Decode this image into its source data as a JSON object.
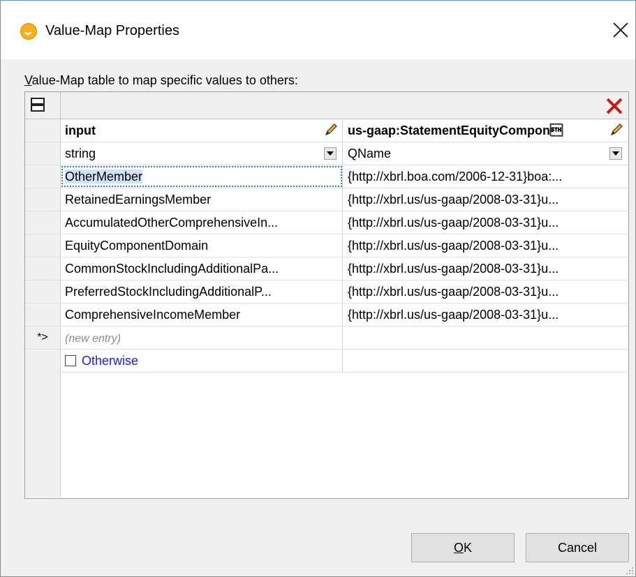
{
  "window": {
    "title": "Value-Map Properties",
    "icon": "altova-mapforce-icon"
  },
  "description": {
    "first_letter": "V",
    "rest": "alue-Map table to map specific values to others:"
  },
  "table": {
    "columns": [
      {
        "header": "input",
        "type": "string"
      },
      {
        "header": "us-gaap:StatementEquityCompon\u0002",
        "type": "QName"
      }
    ],
    "rows": [
      {
        "input": "OtherMember",
        "output": "{http://xbrl.boa.com/2006-12-31}boa:..."
      },
      {
        "input": "RetainedEarningsMember",
        "output": "{http://xbrl.us/us-gaap/2008-03-31}u..."
      },
      {
        "input": "AccumulatedOtherComprehensiveIn...",
        "output": "{http://xbrl.us/us-gaap/2008-03-31}u..."
      },
      {
        "input": "EquityComponentDomain",
        "output": "{http://xbrl.us/us-gaap/2008-03-31}u..."
      },
      {
        "input": "CommonStockIncludingAdditionalPa...",
        "output": "{http://xbrl.us/us-gaap/2008-03-31}u..."
      },
      {
        "input": "PreferredStockIncludingAdditionalP...",
        "output": "{http://xbrl.us/us-gaap/2008-03-31}u..."
      },
      {
        "input": "ComprehensiveIncomeMember",
        "output": "{http://xbrl.us/us-gaap/2008-03-31}u..."
      }
    ],
    "new_entry_marker": "*>",
    "new_entry_placeholder": "(new entry)",
    "otherwise_label": "Otherwise"
  },
  "buttons": {
    "ok_underline": "O",
    "ok_rest": "K",
    "cancel": "Cancel"
  },
  "colors": {
    "delete": "#c81a1a",
    "otherwise_link": "#1a1af0",
    "selection": "#cfe2f7"
  }
}
